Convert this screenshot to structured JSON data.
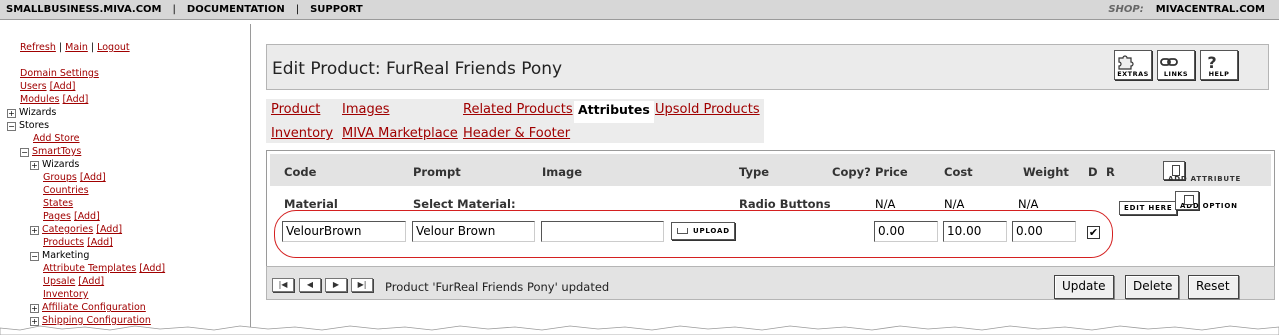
{
  "topnav": {
    "items": [
      "SMALLBUSINESS.MIVA.COM",
      "DOCUMENTATION",
      "SUPPORT"
    ],
    "separator": "|",
    "shop_label": "SHOP:",
    "shop_name": "MIVACENTRAL.COM"
  },
  "sidebar": {
    "refresh": "Refresh",
    "main": "Main",
    "logout": "Logout",
    "sep": "|",
    "domain_settings": "Domain Settings",
    "users": "Users",
    "modules": "Modules",
    "add": "[Add]",
    "wizards": "Wizards",
    "stores": "Stores",
    "add_store": "Add Store",
    "smarttoys": "SmartToys",
    "groups": "Groups",
    "countries": "Countries",
    "states": "States",
    "pages": "Pages",
    "categories": "Categories",
    "products": "Products",
    "marketing": "Marketing",
    "attribute_templates": "Attribute Templates",
    "upsale": "Upsale",
    "inventory": "Inventory",
    "affiliate_configuration": "Affiliate Configuration",
    "shipping_configuration": "Shipping Configuration",
    "plus": "+",
    "minus": "−"
  },
  "page": {
    "title": "Edit Product: FurReal Friends Pony",
    "extras": "EXTRAS",
    "links": "LINKS",
    "help": "HELP"
  },
  "tabs": [
    {
      "label": "Product"
    },
    {
      "label": "Images"
    },
    {
      "label": "Related Products"
    },
    {
      "label": "Attributes"
    },
    {
      "label": "Upsold Products"
    },
    {
      "label": "Inventory"
    },
    {
      "label": "MIVA Marketplace"
    },
    {
      "label": "Header & Footer"
    }
  ],
  "attributes": {
    "columns": [
      "Code",
      "Prompt",
      "Image",
      "Type",
      "Copy?",
      "Price",
      "Cost",
      "Weight",
      "D",
      "R"
    ],
    "add_attribute": "ADD ATTRIBUTE",
    "add_option": "ADD OPTION",
    "edit_here": "EDIT HERE",
    "attribute_row": {
      "code": "Material",
      "prompt": "Select Material:",
      "type": "Radio Buttons",
      "price": "N/A",
      "cost": "N/A",
      "weight": "N/A"
    },
    "option_row": {
      "code": "VelourBrown",
      "prompt": "Velour Brown",
      "image": "",
      "upload": "UPLOAD",
      "price": "0.00",
      "cost": "10.00",
      "weight": "0.00",
      "default_checked": "✔"
    }
  },
  "footer": {
    "status": "Product 'FurReal Friends Pony' updated",
    "update": "Update",
    "delete": "Delete",
    "reset": "Reset"
  },
  "colors": {
    "link": "#a00000",
    "highlight_ring": "#d42020",
    "header_bg": "#e3e3e3"
  }
}
